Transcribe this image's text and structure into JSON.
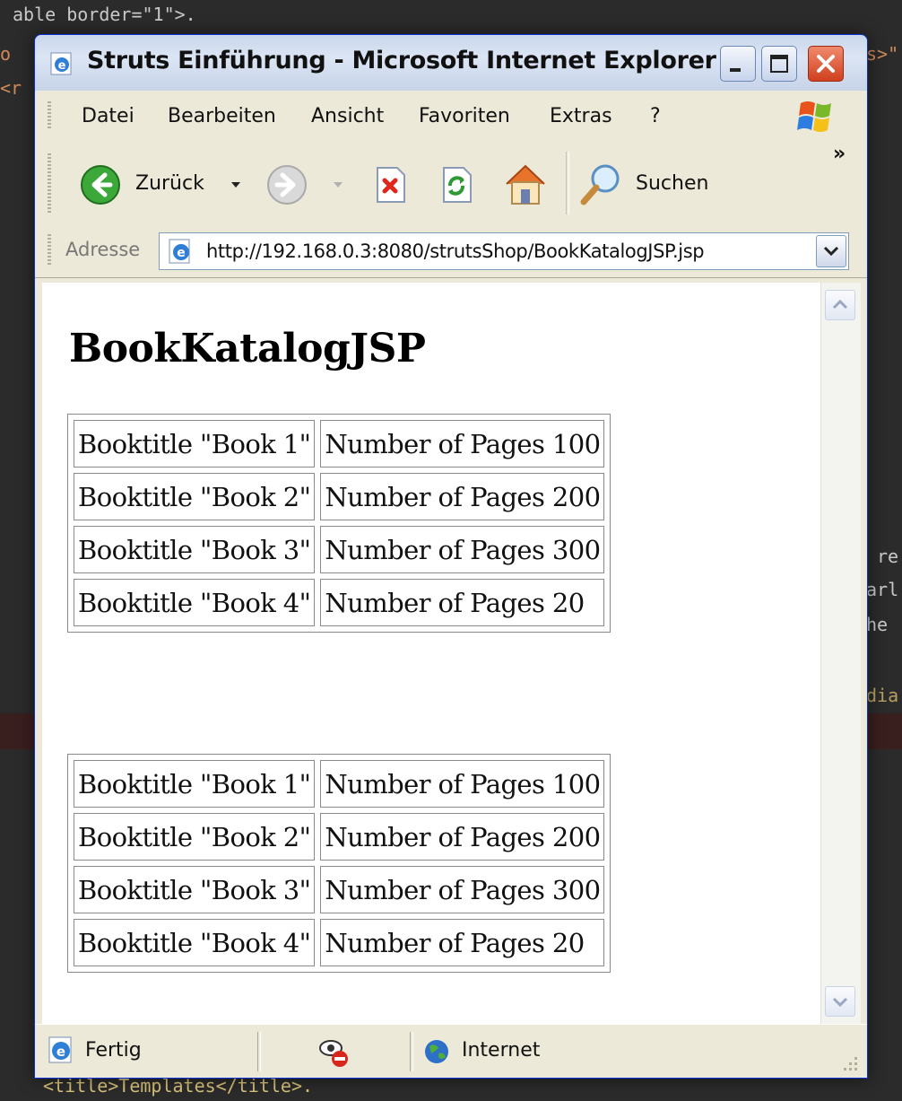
{
  "background_code": {
    "lines": [
      {
        "text": "able border=\"1\">.",
        "color": "#e7c77a"
      },
      {
        "text": "o",
        "color": "#d08a5a"
      },
      {
        "text": "<r",
        "color": "#d08a5a"
      },
      {
        "text": "s>\"",
        "color": "#d08a5a"
      },
      {
        "text": "re",
        "color": "#d8d8d8"
      },
      {
        "text": "arl",
        "color": "#d8d8d8"
      },
      {
        "text": "he",
        "color": "#d8d8d8"
      },
      {
        "text": "dia",
        "color": "#b5a060"
      },
      {
        "text": "<title>Templates</title>.",
        "color": "#d9c27a"
      }
    ]
  },
  "window": {
    "title": "Struts Einführung - Microsoft Internet Explorer",
    "menu": [
      "Datei",
      "Bearbeiten",
      "Ansicht",
      "Favoriten",
      "Extras",
      "?"
    ],
    "toolbar": {
      "back_label": "Zurück",
      "search_label": "Suchen",
      "overflow": "»"
    },
    "address": {
      "label": "Adresse",
      "url": "http://192.168.0.3:8080/strutsShop/BookKatalogJSP.jsp"
    },
    "status": {
      "text": "Fertig",
      "zone": "Internet"
    }
  },
  "page": {
    "heading": "BookKatalogJSP",
    "tables": [
      {
        "rows": [
          [
            "Booktitle \"Book 1\"",
            "Number of Pages 100"
          ],
          [
            "Booktitle \"Book 2\"",
            "Number of Pages 200"
          ],
          [
            "Booktitle \"Book 3\"",
            "Number of Pages 300"
          ],
          [
            "Booktitle \"Book 4\"",
            "Number of Pages 20"
          ]
        ]
      },
      {
        "rows": [
          [
            "Booktitle \"Book 1\"",
            "Number of Pages 100"
          ],
          [
            "Booktitle \"Book 2\"",
            "Number of Pages 200"
          ],
          [
            "Booktitle \"Book 3\"",
            "Number of Pages 300"
          ],
          [
            "Booktitle \"Book 4\"",
            "Number of Pages 20"
          ]
        ]
      }
    ]
  },
  "colors": {
    "window_border": "#0831d9",
    "chrome": "#ece9d8",
    "close_button": "#d0401f",
    "editor_background": "#2b2b2b"
  },
  "icons": [
    "ie-page-icon",
    "back-arrow-icon",
    "forward-arrow-icon",
    "stop-icon",
    "refresh-icon",
    "home-icon",
    "search-magnifier-icon",
    "windows-logo-icon",
    "globe-icon",
    "privacy-blocked-icon"
  ]
}
